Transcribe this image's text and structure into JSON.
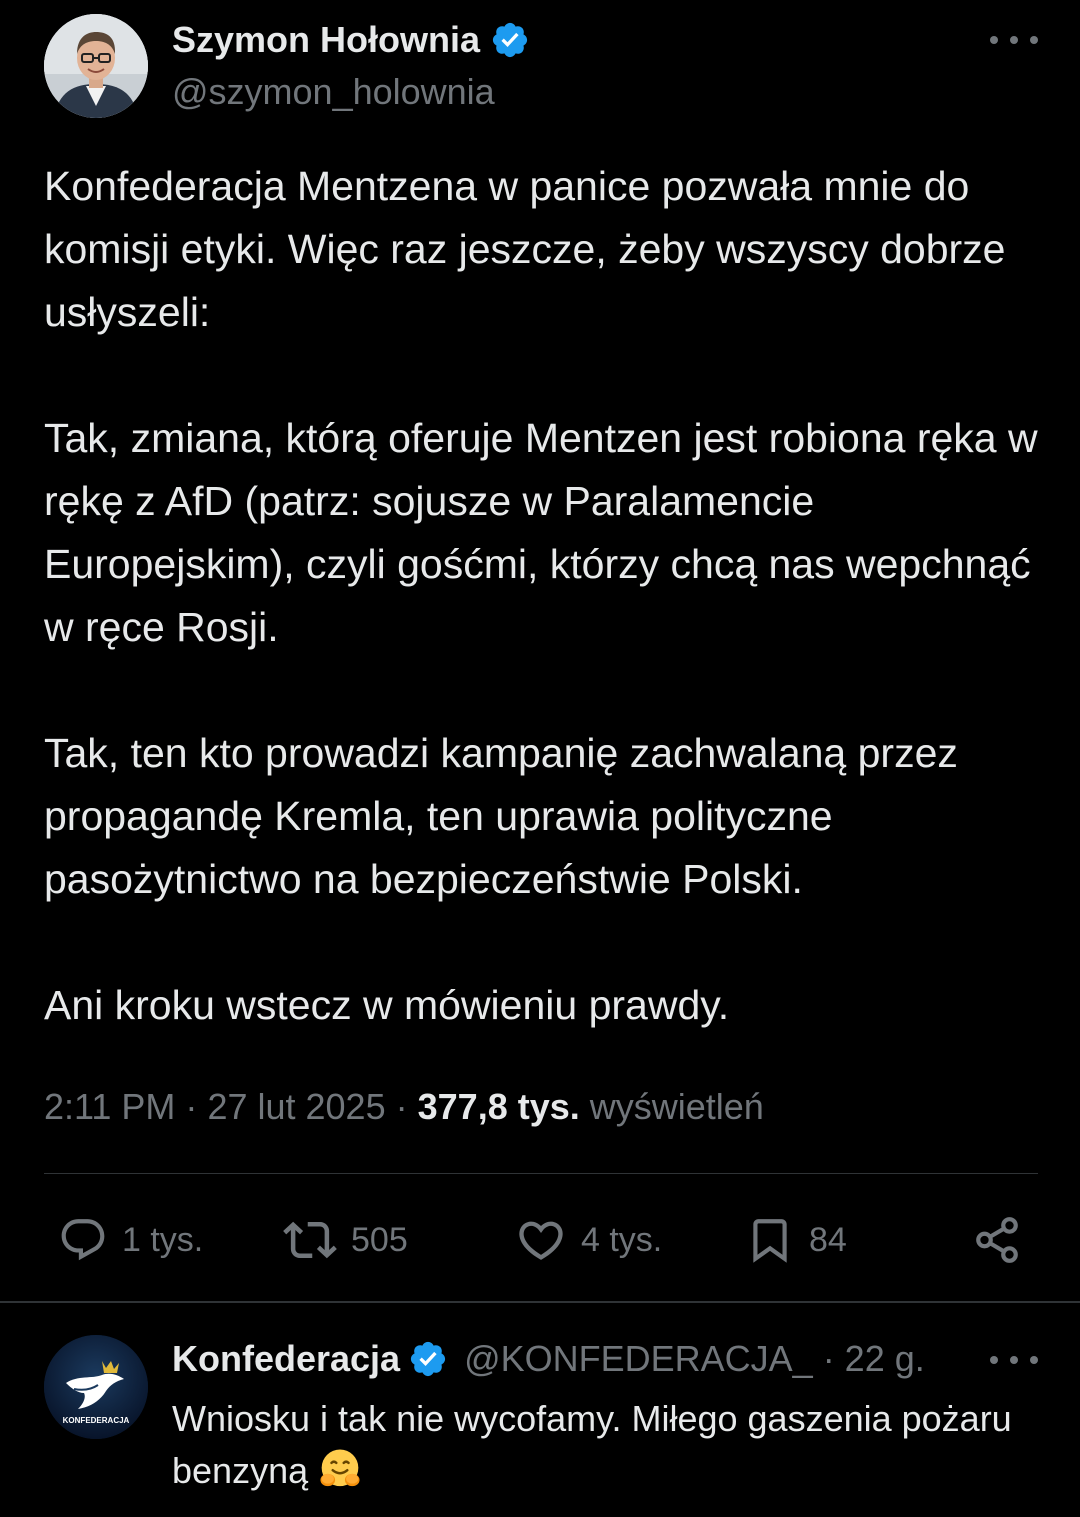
{
  "tweet": {
    "author": {
      "name": "Szymon Hołownia",
      "handle": "@szymon_holownia",
      "verified": true
    },
    "paragraphs": [
      "Konfederacja Mentzena w panice pozwała mnie do komisji etyki. Więc raz jeszcze, żeby wszyscy dobrze usłyszeli:",
      "Tak, zmiana, którą oferuje Mentzen jest robiona ręka w rękę z AfD (patrz: sojusze w Paralamencie Europejskim), czyli gośćmi, którzy chcą nas wepchnąć w ręce Rosji.",
      "Tak, ten kto prowadzi kampanię zachwalaną przez propagandę Kremla, ten uprawia polityczne pasożytnictwo na bezpieczeństwie Polski.",
      "Ani kroku wstecz w mówieniu prawdy."
    ],
    "meta": {
      "time": "2:11 PM",
      "separator": "·",
      "date": "27 lut 2025",
      "views_count": "377,8 tys.",
      "views_label": "wyświetleń"
    },
    "actions": {
      "replies": "1 tys.",
      "reposts": "505",
      "likes": "4 tys.",
      "bookmarks": "84"
    }
  },
  "reply": {
    "author": {
      "name": "Konfederacja",
      "handle": "@KONFEDERACJA_",
      "verified": true
    },
    "time": " · 22 g.",
    "text": "Wniosku i tak nie wycofamy. Miłego gaszenia pożaru benzyną",
    "emoji": "hugging-face-emoji",
    "avatar_label": "KONFEDERACJA"
  },
  "icons": {
    "verified": "verified-badge-icon",
    "more": "more-icon",
    "reply": "reply-icon",
    "repost": "repost-icon",
    "like": "like-icon",
    "bookmark": "bookmark-icon",
    "share": "share-icon"
  },
  "colors": {
    "background": "#000000",
    "text": "#e7e9ea",
    "secondary": "#71767b",
    "verified": "#1d9bf0",
    "divider": "#2f3336"
  }
}
